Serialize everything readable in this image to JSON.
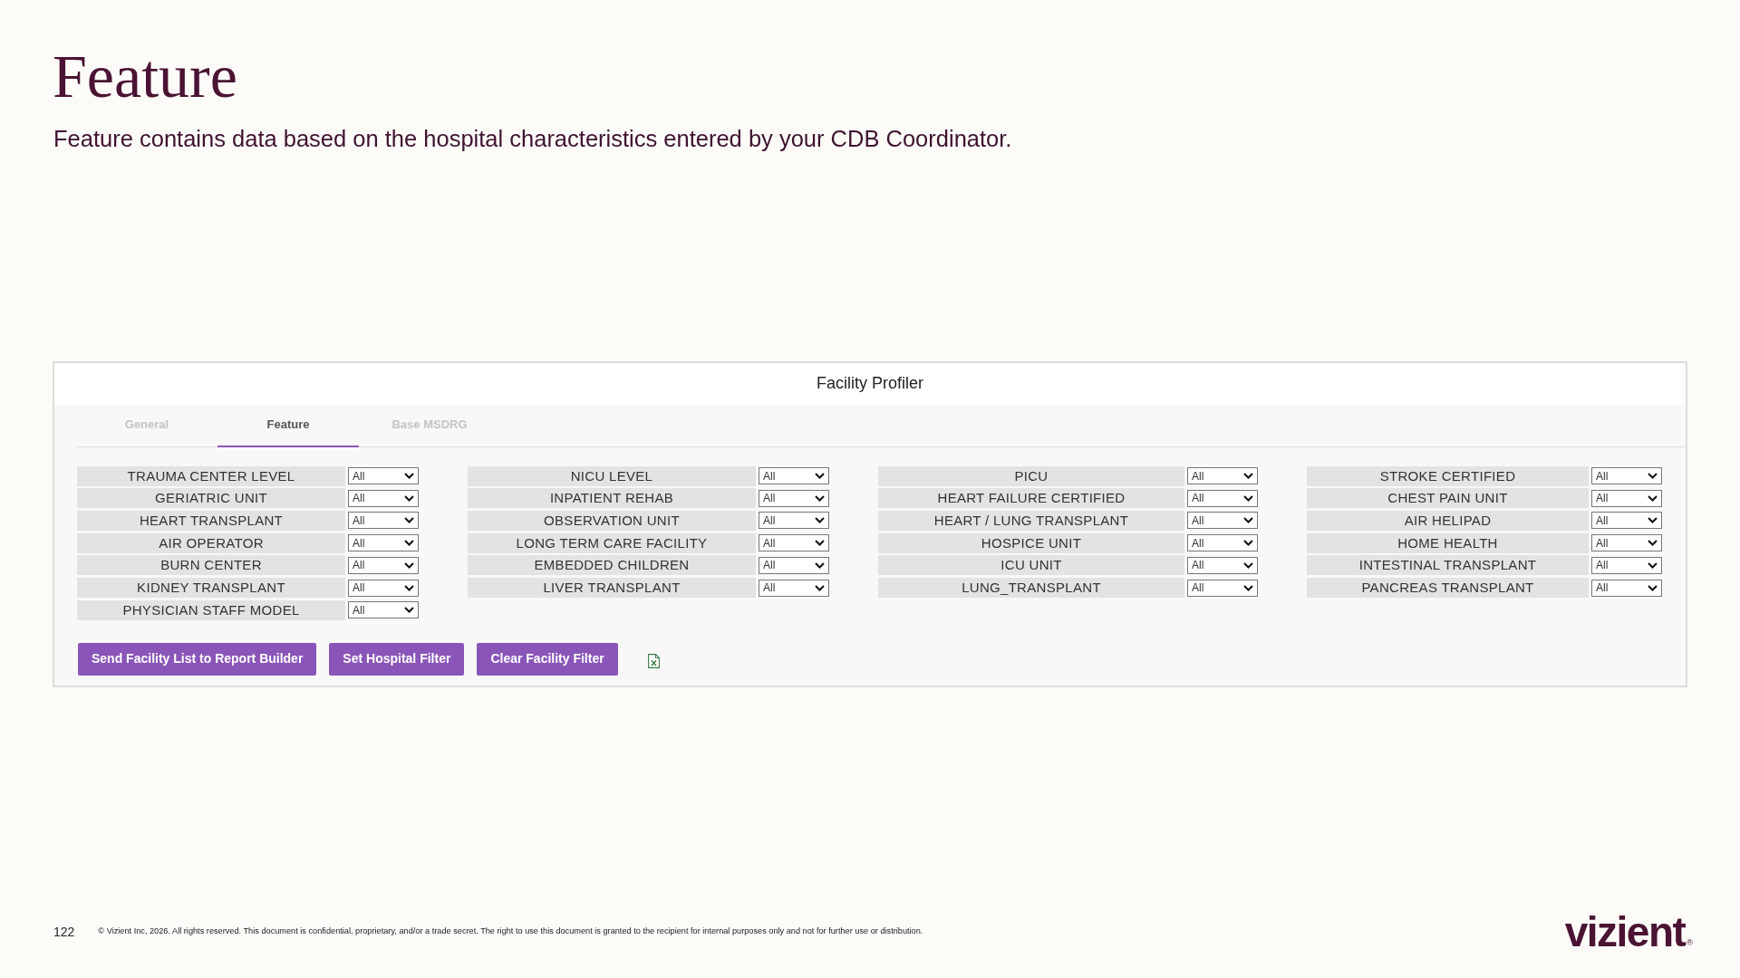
{
  "slide": {
    "title": "Feature",
    "subtitle": "Feature contains data based on the hospital characteristics entered by your CDB Coordinator."
  },
  "panel": {
    "title": "Facility Profiler",
    "tabs": [
      {
        "label": "General",
        "selected": false
      },
      {
        "label": "Feature",
        "selected": true
      },
      {
        "label": "Base MSDRG",
        "selected": false
      }
    ],
    "filter_columns": [
      [
        {
          "label": "TRAUMA CENTER LEVEL",
          "value": "All"
        },
        {
          "label": "GERIATRIC UNIT",
          "value": "All"
        },
        {
          "label": "HEART TRANSPLANT",
          "value": "All"
        },
        {
          "label": "AIR OPERATOR",
          "value": "All"
        },
        {
          "label": "BURN CENTER",
          "value": "All"
        },
        {
          "label": "KIDNEY TRANSPLANT",
          "value": "All"
        },
        {
          "label": "PHYSICIAN STAFF MODEL",
          "value": "All"
        }
      ],
      [
        {
          "label": "NICU LEVEL",
          "value": "All"
        },
        {
          "label": "INPATIENT REHAB",
          "value": "All"
        },
        {
          "label": "OBSERVATION UNIT",
          "value": "All"
        },
        {
          "label": "LONG TERM CARE FACILITY",
          "value": "All"
        },
        {
          "label": "EMBEDDED CHILDREN",
          "value": "All"
        },
        {
          "label": "LIVER TRANSPLANT",
          "value": "All"
        }
      ],
      [
        {
          "label": "PICU",
          "value": "All"
        },
        {
          "label": "HEART FAILURE CERTIFIED",
          "value": "All"
        },
        {
          "label": "HEART / LUNG TRANSPLANT",
          "value": "All"
        },
        {
          "label": "HOSPICE UNIT",
          "value": "All"
        },
        {
          "label": "ICU UNIT",
          "value": "All"
        },
        {
          "label": "LUNG_TRANSPLANT",
          "value": "All"
        }
      ],
      [
        {
          "label": "STROKE CERTIFIED",
          "value": "All"
        },
        {
          "label": "CHEST PAIN UNIT",
          "value": "All"
        },
        {
          "label": "AIR HELIPAD",
          "value": "All"
        },
        {
          "label": "HOME HEALTH",
          "value": "All"
        },
        {
          "label": "INTESTINAL TRANSPLANT",
          "value": "All"
        },
        {
          "label": "PANCREAS TRANSPLANT",
          "value": "All"
        }
      ]
    ],
    "buttons": [
      "Send Facility List to Report Builder",
      "Set Hospital Filter",
      "Clear Facility Filter"
    ]
  },
  "footer": {
    "page_number": "122",
    "copyright": "© Vizient Inc, 2026. All rights reserved. This document is confidential, proprietary, and/or a trade secret. The right to use this document is granted to the recipient for internal purposes only and not for further use or distribution.",
    "logo": {
      "text": "vizient",
      "mark": "®"
    }
  }
}
